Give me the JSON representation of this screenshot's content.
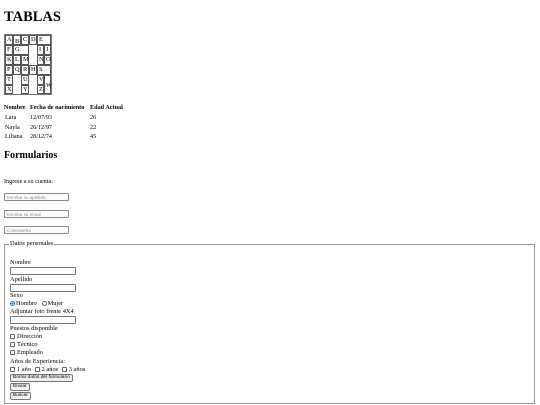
{
  "page_title": "TABLAS",
  "letters_grid": {
    "A": "A",
    "B": "B",
    "C": "C",
    "D": "D",
    "E": "E",
    "F": "F",
    "G": "G",
    "I": "I",
    "J": "J",
    "K": "K",
    "L": "L",
    "M": "M",
    "N": "N",
    "O": "O",
    "P": "P",
    "Q": "Q",
    "R": "R",
    "H": "H",
    "S": "S",
    "T": "T",
    "U": "U",
    "V": "V",
    "X": "X",
    "Y": "Y",
    "Z": "Z",
    "W": "W"
  },
  "people_table": {
    "headers": [
      "Nombre",
      "Fecha de nacimiento",
      "Edad Actual"
    ],
    "rows": [
      [
        "Lara",
        "12/07/93",
        "26"
      ],
      [
        "Nayla",
        "26/12/97",
        "22"
      ],
      [
        "Liliana",
        "28/12/74",
        "45"
      ]
    ]
  },
  "forms_heading": "Formularios",
  "login": {
    "prompt": "Ingrese a su cuenta:",
    "surname_placeholder": "Escriba su apellido",
    "email_placeholder": "Escriba su email",
    "password_placeholder": "Contraseña"
  },
  "personal": {
    "legend": "Datos personales",
    "nombre_label": "Nombre",
    "apellido_label": "Apellido",
    "sexo_label": "Sexo",
    "sexo_options": [
      "Hombre",
      "Mujer"
    ],
    "sexo_selected": "Hombre",
    "foto_label": "Adjuntar foto frente 4X4",
    "puestos_label": "Puestos disponible",
    "puestos": [
      "Dirección",
      "Técnico",
      "Empleado"
    ],
    "experiencia_label": "Años de Experiencia:",
    "experiencia_options": [
      "1 año",
      "2 años",
      "3 años"
    ],
    "reset_button": "Borrar datos del formulario",
    "submit_button": "Enviar",
    "search_button": "Buscar"
  }
}
